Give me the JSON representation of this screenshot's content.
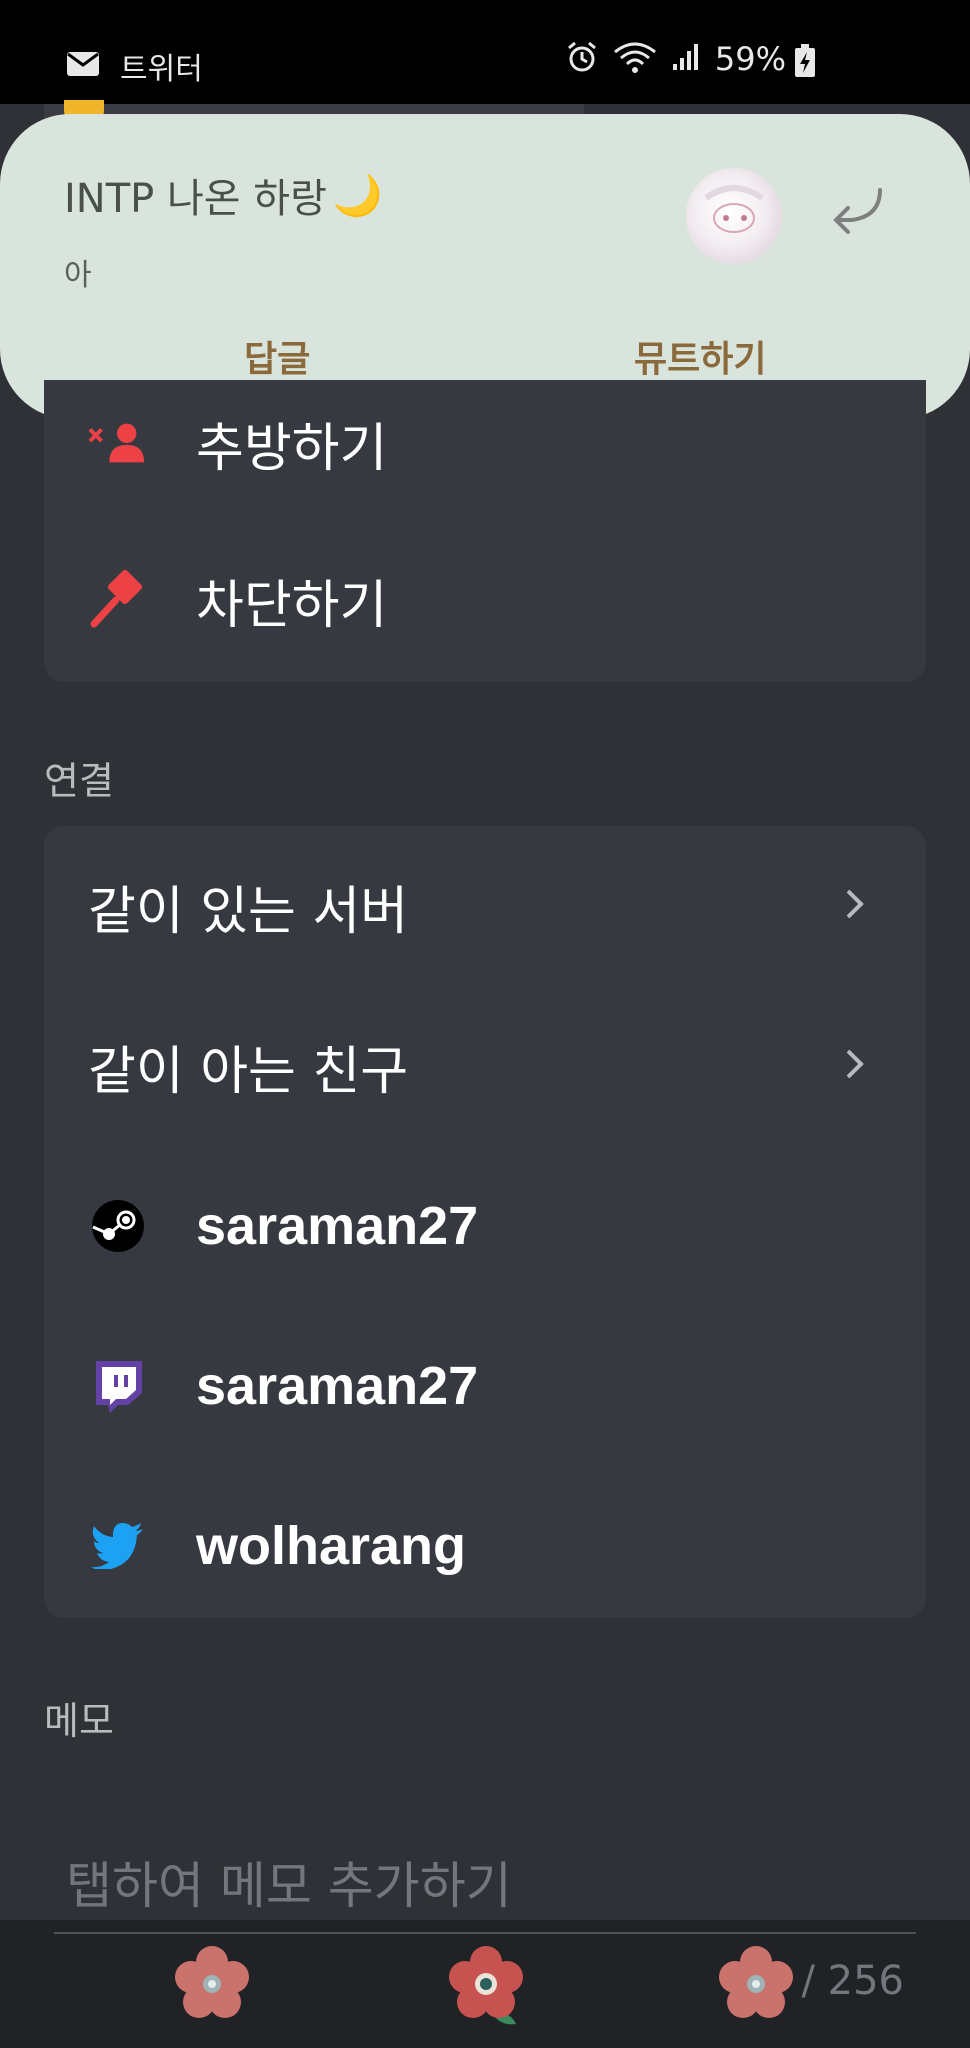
{
  "status_bar": {
    "app_name": "트위터",
    "battery_percent": "59%"
  },
  "notification": {
    "title": "INTP 나온 하랑",
    "title_emoji": "🌙",
    "message": "아",
    "actions": [
      {
        "label": "답글"
      },
      {
        "label": "뮤트하기"
      }
    ]
  },
  "actions_card": {
    "items": [
      {
        "label": "추방하기",
        "icon": "kick-user-icon"
      },
      {
        "label": "차단하기",
        "icon": "ban-hammer-icon"
      }
    ]
  },
  "connections": {
    "section_title": "연결",
    "nav_items": [
      {
        "label": "같이 있는 서버"
      },
      {
        "label": "같이 아는 친구"
      }
    ],
    "accounts": [
      {
        "service": "steam",
        "icon": "steam-icon",
        "username": "saraman27"
      },
      {
        "service": "twitch",
        "icon": "twitch-icon",
        "username": "saraman27"
      },
      {
        "service": "twitter",
        "icon": "twitter-icon",
        "username": "wolharang"
      }
    ]
  },
  "memo": {
    "section_title": "메모",
    "placeholder": "탭하여 메모 추가하기",
    "counter": "0 / 256"
  },
  "colors": {
    "background": "#2f3136",
    "card": "#36393f",
    "notification_bg": "#d9e5dc",
    "danger": "#ed4245",
    "twitch": "#6441a5",
    "twitter": "#1da1f2"
  }
}
